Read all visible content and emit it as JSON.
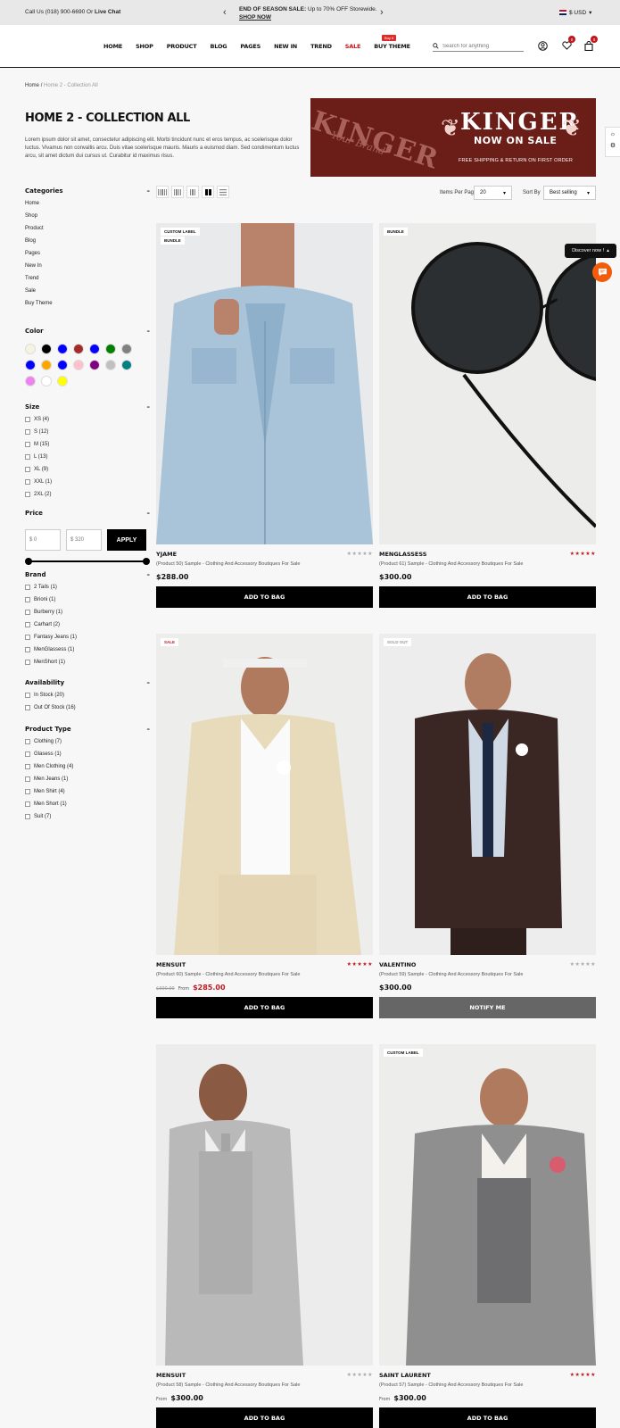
{
  "topbar": {
    "phone_prefix": "Call Us (018) 900-6690 Or",
    "phone_link": "Live Chat",
    "promo_bold": "END OF SEASON SALE:",
    "promo_text": "Up to 70% OFF Storewide.",
    "promo_link": "SHOP NOW",
    "currency": "$ USD"
  },
  "nav": {
    "items": [
      "HOME",
      "SHOP",
      "PRODUCT",
      "BLOG",
      "PAGES",
      "NEW IN",
      "TREND",
      "SALE",
      "BUY THEME"
    ],
    "new_badge": "Buy it",
    "search_placeholder": "Search for anything",
    "wishlist_count": "0",
    "cart_count": "0"
  },
  "breadcrumb": {
    "home": "Home",
    "current": "Home 2 - Collection All"
  },
  "page": {
    "title": "HOME 2 - COLLECTION ALL",
    "description": "Lorem ipsum dolor sit amet, consectetur adipiscing elit. Morbi tincidunt nunc et eros tempus, ac scelerisque dolor luctus. Vivamus non convallis arcu. Duis vitae scelerisque mauris. Mauris a euismod diam. Sed condimentum luctus arcu, sit amet dictum dui cursus ut. Curabitur id maximus risus."
  },
  "banner": {
    "brand_left": "KINGER",
    "tagline_left": "Your Brand",
    "brand_right": "KINGER",
    "sale": "NOW ON SALE",
    "shipping": "FREE SHIPPING & RETURN ON FIRST ORDER"
  },
  "sidebar": {
    "categories_title": "Categories",
    "categories": [
      "Home",
      "Shop",
      "Product",
      "Blog",
      "Pages",
      "New In",
      "Trend",
      "Sale",
      "Buy Theme"
    ],
    "color_title": "Color",
    "colors": [
      "#f6f4e1",
      "#000000",
      "#0000ff",
      "#a52a2a",
      "#0000ff",
      "#008000",
      "#808080",
      "#0000ff",
      "#ffa500",
      "#0000ff",
      "#ffc0cb",
      "#800080",
      "#c0c0c0",
      "#008080",
      "#ee82ee",
      "#ffffff",
      "#ffff00"
    ],
    "size_title": "Size",
    "sizes": [
      "XS (4)",
      "S (12)",
      "M (15)",
      "L (13)",
      "XL (9)",
      "XXL (1)",
      "2XL (2)"
    ],
    "price_title": "Price",
    "price_min": "$ 0",
    "price_max": "$ 320",
    "apply": "APPLY",
    "brand_title": "Brand",
    "brands": [
      "2 Tails (1)",
      "Brioni (1)",
      "Burberry (1)",
      "Carhart (2)",
      "Fantasy Jeans (1)",
      "MenGlassess (1)",
      "MenShort (1)"
    ],
    "availability_title": "Availability",
    "availability": [
      "In Stock (20)",
      "Out Of Stock (16)"
    ],
    "type_title": "Product Type",
    "types": [
      "Clothing (7)",
      "Glasess (1)",
      "Men Clothing (4)",
      "Men Jeans (1)",
      "Men Shirt (4)",
      "Men Short (1)",
      "Suit (7)"
    ],
    "toggle": "–"
  },
  "toolbar": {
    "per_page_label": "Items Per Page",
    "per_page_value": "20",
    "sort_label": "Sort By",
    "sort_value": "Best selling"
  },
  "products": [
    {
      "name": "YJAME",
      "sub": "(Product 50) Sample - Clothing And Accessory Boutiques For Sale",
      "price": "$288.00",
      "button": "ADD TO BAG",
      "label1": "CUSTOM LABEL",
      "label2": "BUNDLE",
      "stars": "★★★★★"
    },
    {
      "name": "MENGLASSESS",
      "sub": "(Product 61) Sample - Clothing And Accessory Boutiques For Sale",
      "price": "$300.00",
      "button": "ADD TO BAG",
      "label1": "BUNDLE",
      "stars": "★★★★★"
    },
    {
      "name": "MENSUIT",
      "sub": "(Product 60) Sample - Clothing And Accessory Boutiques For Sale",
      "old_price": "$300.00",
      "from": "From",
      "price": "$285.00",
      "button": "ADD TO BAG",
      "label1": "SALE",
      "stars": "★★★★★"
    },
    {
      "name": "VALENTINO",
      "sub": "(Product 59) Sample - Clothing And Accessory Boutiques For Sale",
      "price": "$300.00",
      "button": "NOTIFY ME",
      "label1": "SOLD OUT",
      "stars": "★★★★★"
    },
    {
      "name": "MENSUIT",
      "sub": "(Product 58) Sample - Clothing And Accessory Boutiques For Sale",
      "from": "From",
      "price": "$300.00",
      "button": "ADD TO BAG",
      "stars": "★★★★★"
    },
    {
      "name": "SAINT LAURENT",
      "sub": "(Product 57) Sample - Clothing And Accessory Boutiques For Sale",
      "from": "From",
      "price": "$300.00",
      "button": "ADD TO BAG",
      "label1": "CUSTOM LABEL",
      "stars": "★★★★★"
    }
  ],
  "widgets": {
    "discover": "Discover now !"
  },
  "theme": {
    "accent": "#c0171d",
    "banner_bg": "#6b1d17",
    "chat": "#f25c0a"
  }
}
